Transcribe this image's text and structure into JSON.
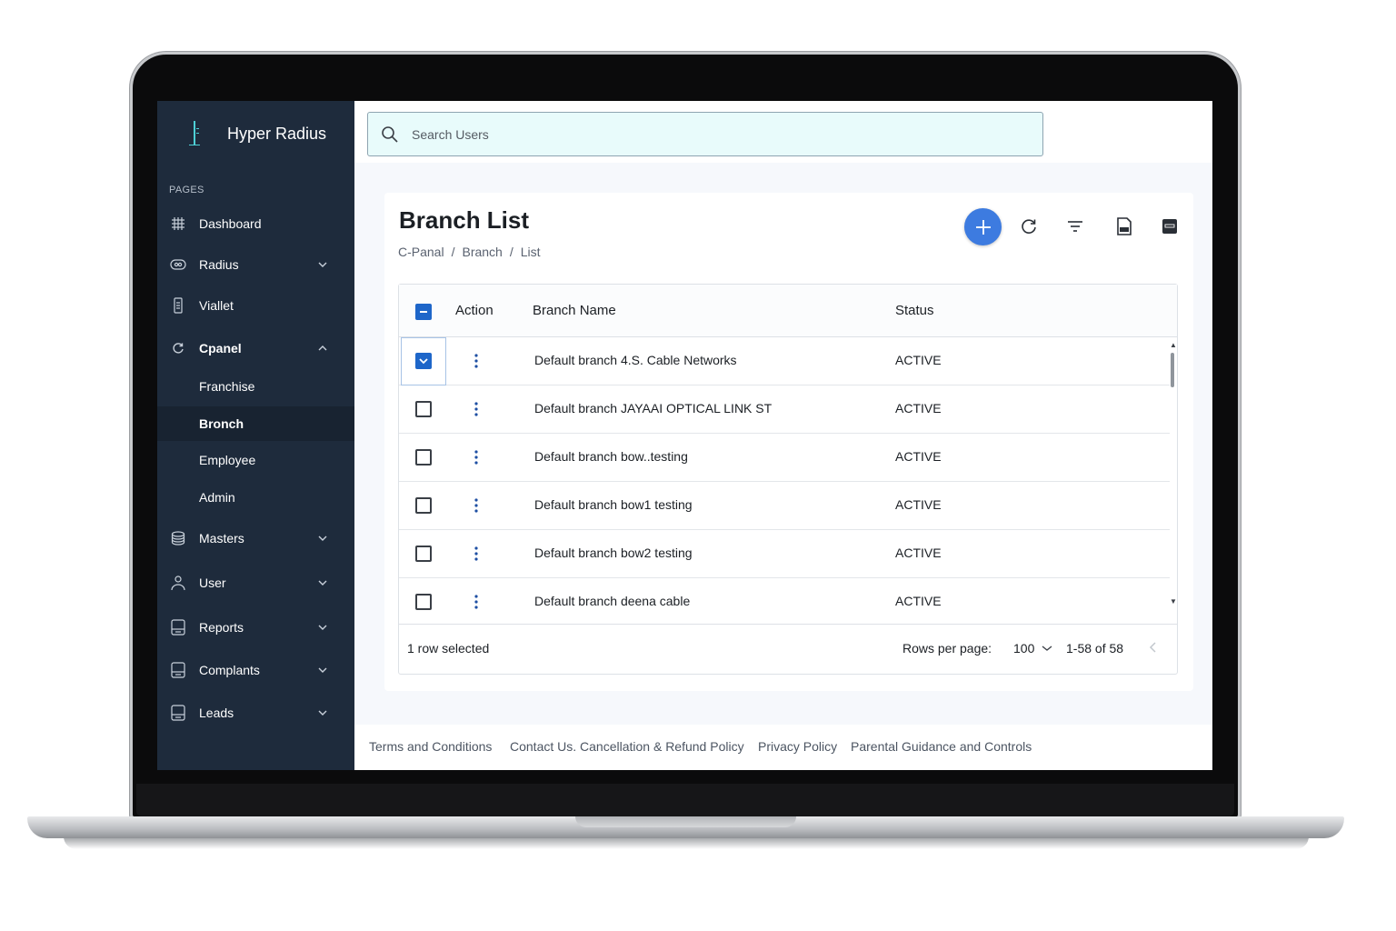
{
  "app": {
    "name": "Hyper Radius"
  },
  "sidebar": {
    "section_label": "PAGES",
    "items": [
      {
        "label": "Dashboard",
        "icon": "grid-icon"
      },
      {
        "label": "Radius",
        "icon": "radius-icon"
      },
      {
        "label": "Viallet",
        "icon": "wallet-icon"
      },
      {
        "label": "Cpanel",
        "icon": "refresh-icon"
      },
      {
        "label": "Masters",
        "icon": "database-icon"
      },
      {
        "label": "User",
        "icon": "user-icon"
      },
      {
        "label": "Reports",
        "icon": "reports-icon"
      },
      {
        "label": "Complants",
        "icon": "complaints-icon"
      },
      {
        "label": "Leads",
        "icon": "leads-icon"
      }
    ],
    "cpanel_sub": [
      {
        "label": "Franchise"
      },
      {
        "label": "Bronch"
      },
      {
        "label": "Employee"
      },
      {
        "label": "Admin"
      }
    ]
  },
  "search": {
    "placeholder": "Search Users"
  },
  "page": {
    "title": "Branch List",
    "breadcrumb": [
      "C-Panal",
      "Branch",
      "List"
    ]
  },
  "table": {
    "columns": {
      "action": "Action",
      "branch_name": "Branch Name",
      "status": "Status"
    },
    "rows": [
      {
        "name": "Default branch 4.S. Cable Networks",
        "status": "ACTIVE",
        "checked": true
      },
      {
        "name": "Default branch JAYAAI OPTICAL LINK ST",
        "status": "ACTIVE",
        "checked": false
      },
      {
        "name": "Default branch bow..testing",
        "status": "ACTIVE",
        "checked": false
      },
      {
        "name": "Default branch bow1 testing",
        "status": "ACTIVE",
        "checked": false
      },
      {
        "name": "Default branch bow2 testing",
        "status": "ACTIVE",
        "checked": false
      },
      {
        "name": "Default branch deena cable",
        "status": "ACTIVE",
        "checked": false
      }
    ],
    "footer": {
      "selected_text": "1 row selected",
      "rows_per_page_label": "Rows per page:",
      "rows_per_page_value": "100",
      "range": "1-58 of 58"
    }
  },
  "footer_links": [
    "Terms and Conditions",
    "Contact Us. Cancellation & Refund Policy",
    "Privacy Policy",
    "Parental Guidance and Controls"
  ],
  "colors": {
    "sidebar_bg": "#1e2b3c",
    "accent": "#3d7be0",
    "checkbox_checked": "#1e66c9",
    "search_bg": "#e8fbfb",
    "brand_logo": "#4ed0d6"
  }
}
